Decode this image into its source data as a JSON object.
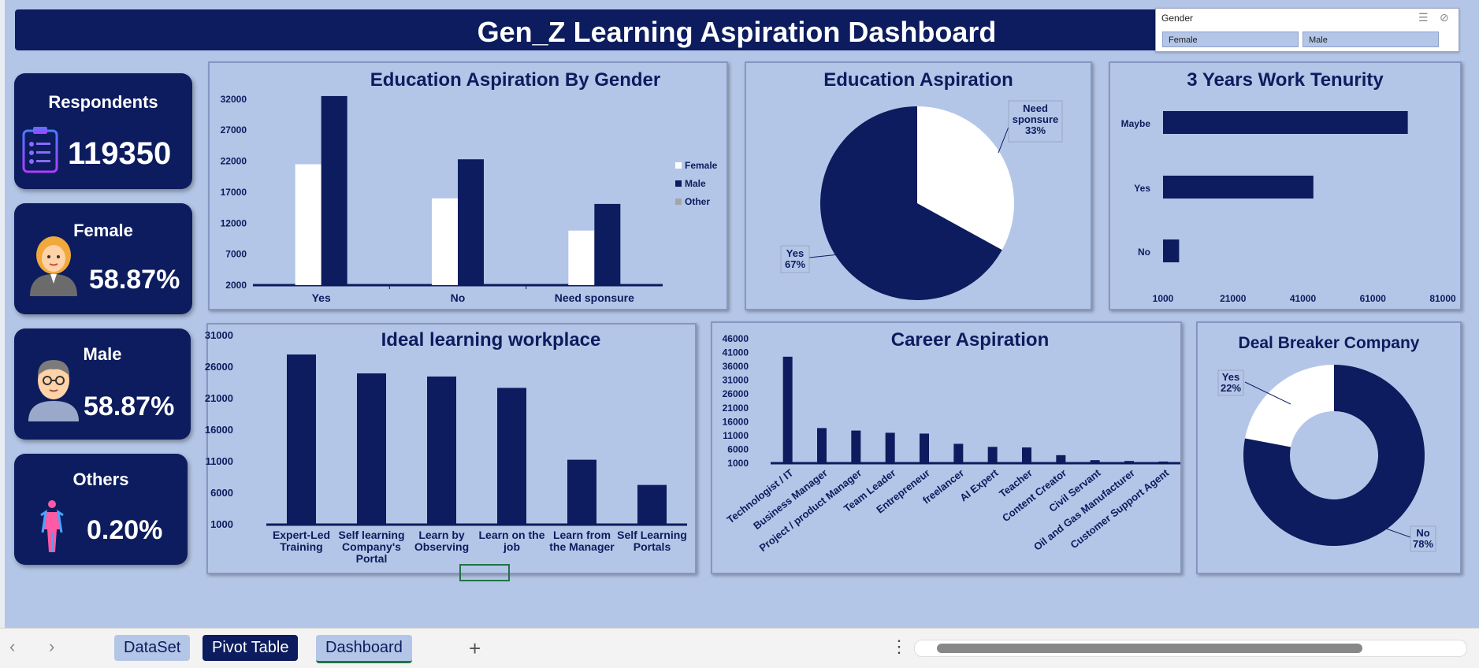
{
  "header": {
    "title": "Gen_Z Learning Aspiration Dashboard"
  },
  "slicer": {
    "title": "Gender",
    "options": [
      "Female",
      "Male"
    ]
  },
  "kpis": {
    "respondents": {
      "label": "Respondents",
      "value": "119350"
    },
    "female": {
      "label": "Female",
      "value": "58.87%"
    },
    "male": {
      "label": "Male",
      "value": "58.87%"
    },
    "others": {
      "label": "Others",
      "value": "0.20%"
    }
  },
  "colors": {
    "navy": "#0c1c5e",
    "bg": "#b4c6e7",
    "white": "#ffffff",
    "other": "#a5a5a5"
  },
  "chart_data": [
    {
      "type": "bar",
      "title": "Education Aspiration By Gender",
      "categories": [
        "Yes",
        "No",
        "Need sponsure"
      ],
      "series": [
        {
          "name": "Female",
          "values": [
            21500,
            16000,
            10800
          ]
        },
        {
          "name": "Male",
          "values": [
            32500,
            22300,
            15100
          ]
        },
        {
          "name": "Other",
          "values": [
            0,
            0,
            0
          ]
        }
      ],
      "yticks": [
        "2000",
        "7000",
        "12000",
        "17000",
        "22000",
        "27000",
        "32000"
      ],
      "ylim": [
        2000,
        33000
      ],
      "legend": "right"
    },
    {
      "type": "pie",
      "title": "Education Aspiration",
      "slices": [
        {
          "name": "Need sponsure",
          "value": 33,
          "label": "Need sponsure 33%"
        },
        {
          "name": "Yes",
          "value": 67,
          "label": "Yes 67%"
        }
      ]
    },
    {
      "type": "bar",
      "orientation": "horizontal",
      "title": "3 Years Work Tenurity",
      "categories": [
        "Maybe",
        "Yes",
        "No"
      ],
      "values": [
        71000,
        44000,
        5600
      ],
      "xticks": [
        "1000",
        "21000",
        "41000",
        "61000",
        "81000"
      ],
      "xlim": [
        1000,
        81000
      ]
    },
    {
      "type": "bar",
      "title": "Ideal learning workplace",
      "categories": [
        "Expert-Led Training",
        "Self learning Company's Portal",
        "Learn by Observing",
        "Learn on the job",
        "Learn from the Manager",
        "Self Learning Portals"
      ],
      "values": [
        28000,
        25000,
        24500,
        22700,
        11300,
        7300
      ],
      "yticks": [
        "1000",
        "6000",
        "11000",
        "16000",
        "21000",
        "26000",
        "31000"
      ],
      "ylim": [
        1000,
        31000
      ]
    },
    {
      "type": "bar",
      "title": "Career Aspiration",
      "categories": [
        "Technologist / IT",
        "Business Manager",
        "Project / product Manager",
        "Team Leader",
        "Entrepreneur",
        "freelancer",
        "AI Expert",
        "Teacher",
        "Content Creator",
        "Civil Servant",
        "Oil and Gas Manufacturer",
        "Customer Support Agent"
      ],
      "values": [
        39500,
        13700,
        12800,
        12000,
        11700,
        8000,
        6900,
        6700,
        3900,
        2100,
        1800,
        1600
      ],
      "yticks": [
        "1000",
        "6000",
        "11000",
        "16000",
        "21000",
        "26000",
        "31000",
        "36000",
        "41000",
        "46000"
      ],
      "ylim": [
        1000,
        46000
      ]
    },
    {
      "type": "pie",
      "subtype": "donut",
      "title": "Deal Breaker Company",
      "slices": [
        {
          "name": "Yes",
          "value": 22,
          "label": "Yes 22%"
        },
        {
          "name": "No",
          "value": 78,
          "label": "No 78%"
        }
      ]
    }
  ],
  "tabs": [
    {
      "label": "DataSet"
    },
    {
      "label": "Pivot Table"
    },
    {
      "label": "Dashboard"
    }
  ],
  "tabbar": {
    "add": "+",
    "more": "⋮",
    "prev": "‹",
    "next": "›"
  }
}
